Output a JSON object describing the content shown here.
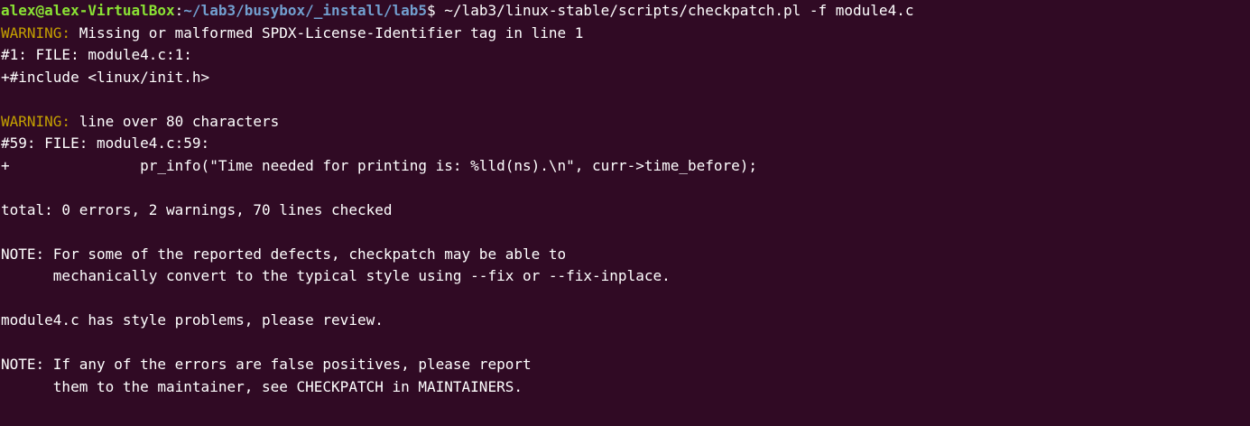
{
  "prompt": {
    "user_host": "alex@alex-VirtualBox",
    "separator": ":",
    "path": "~/lab3/busybox/_install/lab5",
    "symbol": "$",
    "command": " ~/lab3/linux-stable/scripts/checkpatch.pl -f module4.c"
  },
  "warning1": {
    "tag": "WARNING:",
    "message": " Missing or malformed SPDX-License-Identifier tag in line 1",
    "location": "#1: FILE: module4.c:1:",
    "code": "+#include <linux/init.h>"
  },
  "warning2": {
    "tag": "WARNING:",
    "message": " line over 80 characters",
    "location": "#59: FILE: module4.c:59:",
    "code": "+               pr_info(\"Time needed for printing is: %lld(ns).\\n\", curr->time_before);"
  },
  "summary": "total: 0 errors, 2 warnings, 70 lines checked",
  "note1": {
    "line1": "NOTE: For some of the reported defects, checkpatch may be able to",
    "line2": "      mechanically convert to the typical style using --fix or --fix-inplace."
  },
  "style_problems": "module4.c has style problems, please review.",
  "note2": {
    "line1": "NOTE: If any of the errors are false positives, please report",
    "line2": "      them to the maintainer, see CHECKPATCH in MAINTAINERS."
  },
  "colors": {
    "background": "#300a24",
    "prompt_user": "#8ae234",
    "prompt_path": "#729fcf",
    "warning": "#c4a000",
    "text": "#ffffff"
  }
}
